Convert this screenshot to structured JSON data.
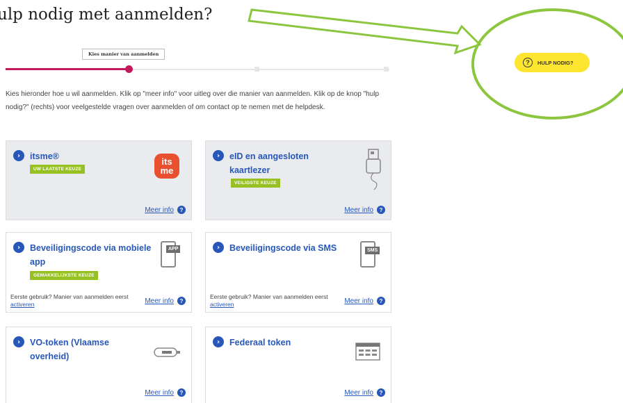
{
  "heading": "ulp nodig met aanmelden?",
  "help_button": {
    "label": "HULP NODIG?",
    "icon": "question-circle-icon",
    "color": "#fde530"
  },
  "stepper": {
    "active_label": "Kies manier van aanmelden",
    "accent": "#c3185a",
    "progress": 0.33
  },
  "intro": "Kies hieronder hoe u wil aanmelden. Klik op \"meer info\" voor uitleg over die manier van aanmelden. Klik op de knop \"hulp nodig?\" (rechts) voor veelgestelde vragen over aanmelden of om contact op te nemen met de helpdesk.",
  "colors": {
    "link": "#2757b8",
    "badge": "#97c123",
    "annotation": "#8cc63f"
  },
  "cards": [
    {
      "title": "itsme®",
      "badge": "UW LAATSTE KEUZE",
      "more": "Meer info",
      "icon": "itsme-logo"
    },
    {
      "title": "eID en aangesloten kaartlezer",
      "badge": "VEILIGSTE KEUZE",
      "more": "Meer info",
      "icon": "card-reader-icon"
    },
    {
      "title": "Beveiligingscode via mobiele app",
      "badge": "GEMAKKELIJKSTE KEUZE",
      "note": "Eerste gebruik? Manier van aanmelden eerst",
      "activate": "activeren",
      "more": "Meer info",
      "icon": "phone-app-icon",
      "icon_text": "APP"
    },
    {
      "title": "Beveiligingscode via SMS",
      "note": "Eerste gebruik? Manier van aanmelden eerst",
      "activate": "activeren",
      "more": "Meer info",
      "icon": "phone-sms-icon",
      "icon_text": "SMS"
    },
    {
      "title": "VO-token (Vlaamse overheid)",
      "more": "Meer info",
      "icon": "token-icon"
    },
    {
      "title": "Federaal token",
      "more": "Meer info",
      "icon": "token-grid-icon"
    }
  ],
  "itsme_logo_text": "its\nme"
}
